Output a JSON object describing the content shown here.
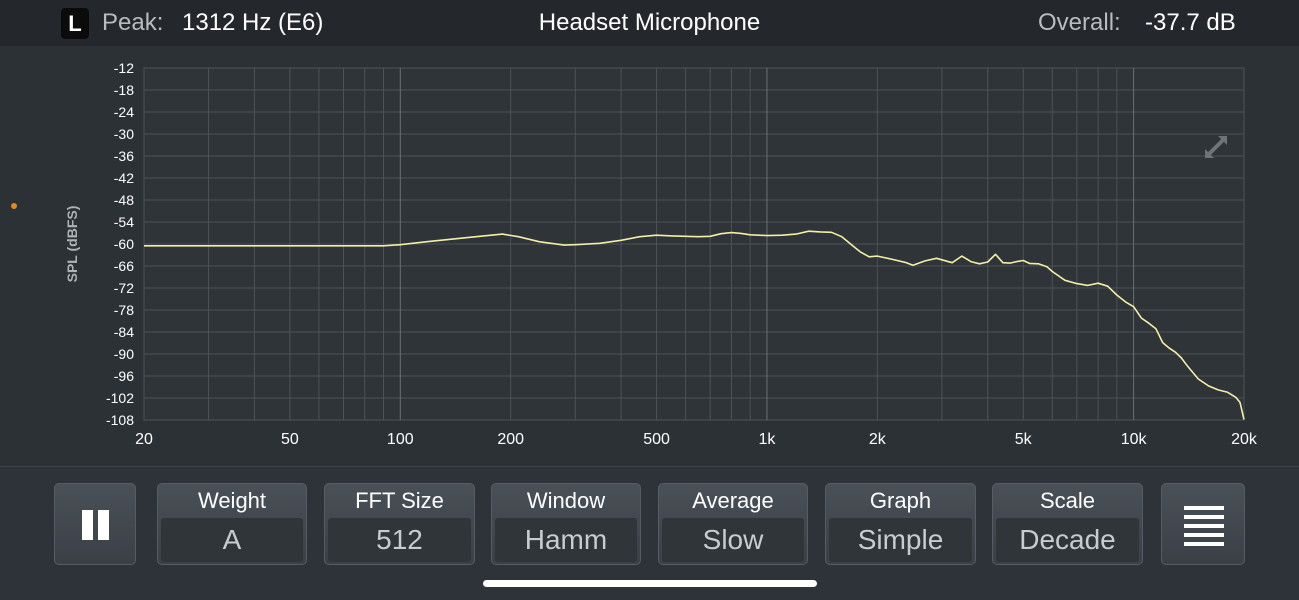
{
  "header": {
    "channel": "L",
    "peak_label": "Peak:",
    "peak_value": "1312 Hz (E6)",
    "title": "Headset Microphone",
    "overall_label": "Overall:",
    "overall_value": "-37.7 dB"
  },
  "chart_data": {
    "type": "line",
    "ylabel": "SPL (dBFS)",
    "xscale": "log",
    "xlim": [
      20,
      20000
    ],
    "ylim": [
      -108,
      -12
    ],
    "yticks": [
      "-12",
      "-18",
      "-24",
      "-30",
      "-36",
      "-42",
      "-48",
      "-54",
      "-60",
      "-66",
      "-72",
      "-78",
      "-84",
      "-90",
      "-96",
      "-102",
      "-108"
    ],
    "xticks": [
      {
        "v": 20,
        "label": "20"
      },
      {
        "v": 50,
        "label": "50"
      },
      {
        "v": 100,
        "label": "100"
      },
      {
        "v": 200,
        "label": "200"
      },
      {
        "v": 500,
        "label": "500"
      },
      {
        "v": 1000,
        "label": "1k"
      },
      {
        "v": 2000,
        "label": "2k"
      },
      {
        "v": 5000,
        "label": "5k"
      },
      {
        "v": 10000,
        "label": "10k"
      },
      {
        "v": 20000,
        "label": "20k"
      }
    ],
    "grid": true,
    "line_color": "#f2efa8",
    "series": [
      {
        "x": [
          20,
          50,
          90,
          100,
          120,
          150,
          190,
          210,
          240,
          280,
          300,
          350,
          400,
          450,
          500,
          550,
          650,
          700,
          750,
          800,
          850,
          900,
          950,
          1000,
          1100,
          1200,
          1300,
          1400,
          1500,
          1600,
          1700,
          1800,
          1900,
          2000,
          2200,
          2400,
          2500,
          2700,
          2900,
          3000,
          3200,
          3400,
          3600,
          3800,
          4000,
          4200,
          4400,
          4600,
          4800,
          5000,
          5200,
          5500,
          5800,
          6000,
          6500,
          7000,
          7200,
          7500,
          8000,
          8500,
          9000,
          9500,
          10000,
          10500,
          11000,
          11500,
          12000,
          12500,
          13000,
          13500,
          14000,
          15000,
          16000,
          17000,
          18000,
          19000,
          19500,
          20000
        ],
        "y": [
          -60.5,
          -60.5,
          -60.5,
          -60.2,
          -59.3,
          -58.3,
          -57.3,
          -58,
          -59.4,
          -60.3,
          -60.2,
          -59.8,
          -59,
          -58,
          -57.6,
          -57.8,
          -58,
          -57.9,
          -57.2,
          -56.9,
          -57.1,
          -57.5,
          -57.6,
          -57.7,
          -57.6,
          -57.3,
          -56.5,
          -56.7,
          -56.8,
          -58,
          -60.2,
          -62.2,
          -63.5,
          -63.3,
          -64.2,
          -65.1,
          -65.8,
          -64.6,
          -63.9,
          -64.3,
          -65.1,
          -63.3,
          -64.8,
          -65.4,
          -64.9,
          -62.8,
          -65.1,
          -65.2,
          -64.8,
          -64.5,
          -65.3,
          -65.4,
          -66.2,
          -67.5,
          -69.9,
          -70.8,
          -71,
          -71.3,
          -70.7,
          -71.5,
          -73.9,
          -75.8,
          -77.1,
          -80.2,
          -81.6,
          -83.1,
          -86.9,
          -88.4,
          -89.5,
          -91.1,
          -93.2,
          -96.8,
          -98.7,
          -99.8,
          -100.4,
          -101.8,
          -103.2,
          -107.9
        ]
      }
    ]
  },
  "toolbar": {
    "buttons": [
      {
        "label": "Weight",
        "value": "A"
      },
      {
        "label": "FFT Size",
        "value": "512"
      },
      {
        "label": "Window",
        "value": "Hamm"
      },
      {
        "label": "Average",
        "value": "Slow"
      },
      {
        "label": "Graph",
        "value": "Simple"
      },
      {
        "label": "Scale",
        "value": "Decade"
      }
    ]
  },
  "icons": {
    "pause": "pause-icon",
    "menu": "hamburger-menu-icon",
    "expand": "expand-arrows-icon"
  }
}
